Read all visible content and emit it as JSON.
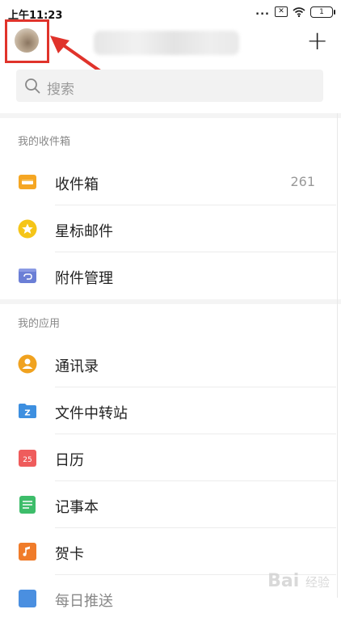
{
  "status": {
    "time": "上午11:23",
    "dots": "...",
    "sim": "✕",
    "battery": "1"
  },
  "header": {
    "add_label": "+"
  },
  "search": {
    "placeholder": "搜索"
  },
  "sections": {
    "mailbox_title": "我的收件箱",
    "apps_title": "我的应用"
  },
  "mailbox_items": [
    {
      "label": "收件箱",
      "count": "261",
      "color": "#f5a623",
      "icon": "inbox-icon"
    },
    {
      "label": "星标邮件",
      "count": "",
      "color": "#f5c518",
      "icon": "star-icon"
    },
    {
      "label": "附件管理",
      "count": "",
      "color": "#6b7fd6",
      "icon": "attachment-icon"
    }
  ],
  "app_items": [
    {
      "label": "通讯录",
      "color": "#f0a21f",
      "icon": "contacts-icon"
    },
    {
      "label": "文件中转站",
      "color": "#3d8fe0",
      "icon": "folder-icon",
      "glyph": "Z"
    },
    {
      "label": "日历",
      "color": "#ef5c5c",
      "icon": "calendar-icon",
      "glyph": "25"
    },
    {
      "label": "记事本",
      "color": "#3dbd6a",
      "icon": "notepad-icon"
    },
    {
      "label": "贺卡",
      "color": "#f07c2a",
      "icon": "card-icon"
    },
    {
      "label": "每日推送",
      "color": "#4a8fe0",
      "icon": "push-icon"
    }
  ],
  "watermark": {
    "main": "Bai",
    "sub": "经验"
  }
}
